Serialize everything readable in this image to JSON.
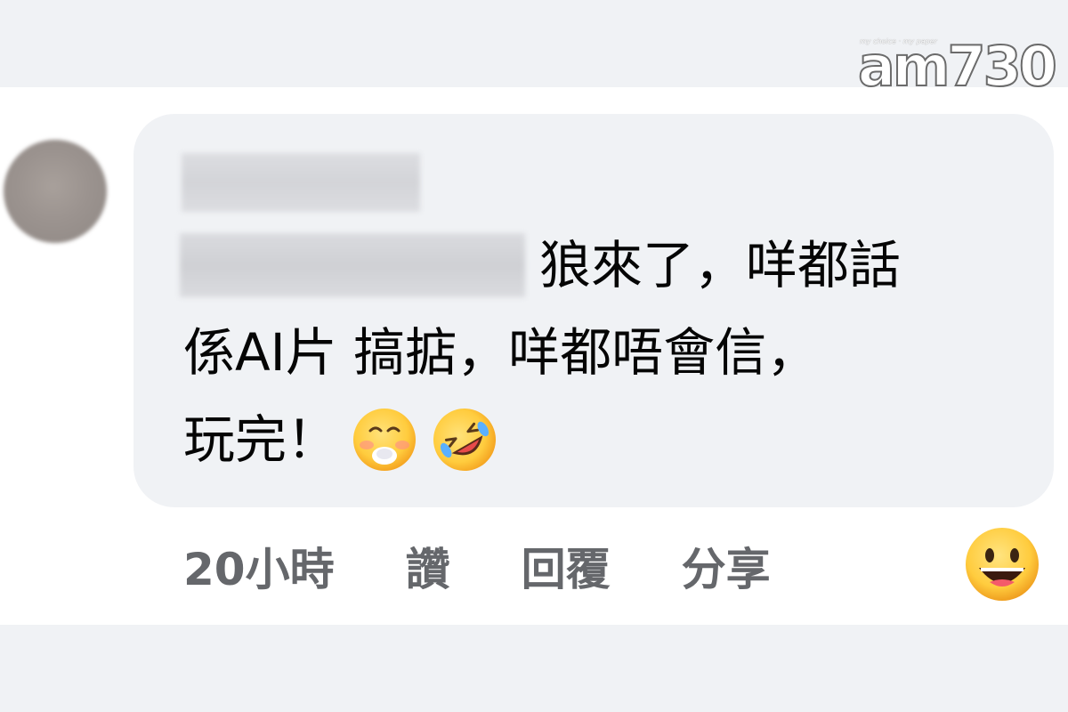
{
  "watermark": {
    "tagline": "my choice · my paper",
    "logo": "am730"
  },
  "comment": {
    "text_line1": "狼來了，咩都話",
    "text_line2": "係AI片 搞掂，咩都唔會信，",
    "text_line3": "玩完！",
    "emojis": [
      "face-with-hand-over-mouth",
      "rolling-on-floor-laughing"
    ]
  },
  "actions": {
    "timestamp": "20小時",
    "like": "讚",
    "reply": "回覆",
    "share": "分享"
  },
  "reaction_icon": "grinning-face",
  "colors": {
    "page_band": "#f0f2f5",
    "bubble": "#f0f2f5",
    "text": "#050505",
    "meta_text": "#65676b",
    "emoji_yellow": "#ffcc3e"
  }
}
